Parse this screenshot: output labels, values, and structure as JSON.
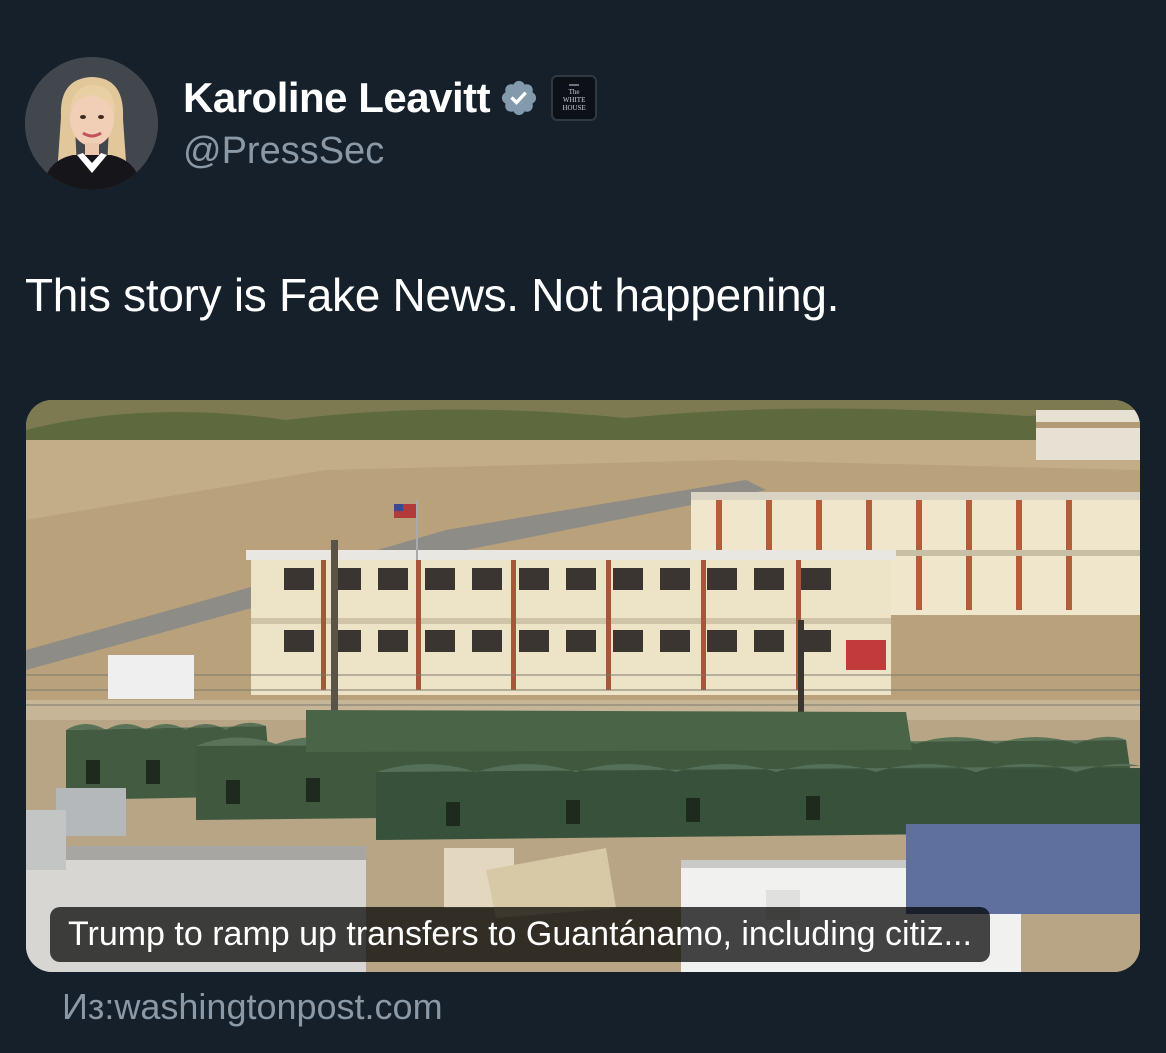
{
  "author": {
    "display_name": "Karoline Leavitt",
    "handle": "@PressSec",
    "verified_icon": "verified-badge-icon",
    "affiliate_badge": {
      "text": "The\nWHITE\nHOUSE",
      "icon": "white-house-badge"
    },
    "avatar": "profile-photo"
  },
  "tweet": {
    "text": "This story is Fake News. Not happening."
  },
  "link_card": {
    "image": "detention-camp-tents-photo",
    "caption": "Trump to ramp up transfers to Guantánamo, including citiz...",
    "source": "Из:washingtonpost.com"
  },
  "colors": {
    "background": "#15202b",
    "text_primary": "#ffffff",
    "text_secondary": "#8b98a5",
    "verified_badge": "#829aab"
  }
}
